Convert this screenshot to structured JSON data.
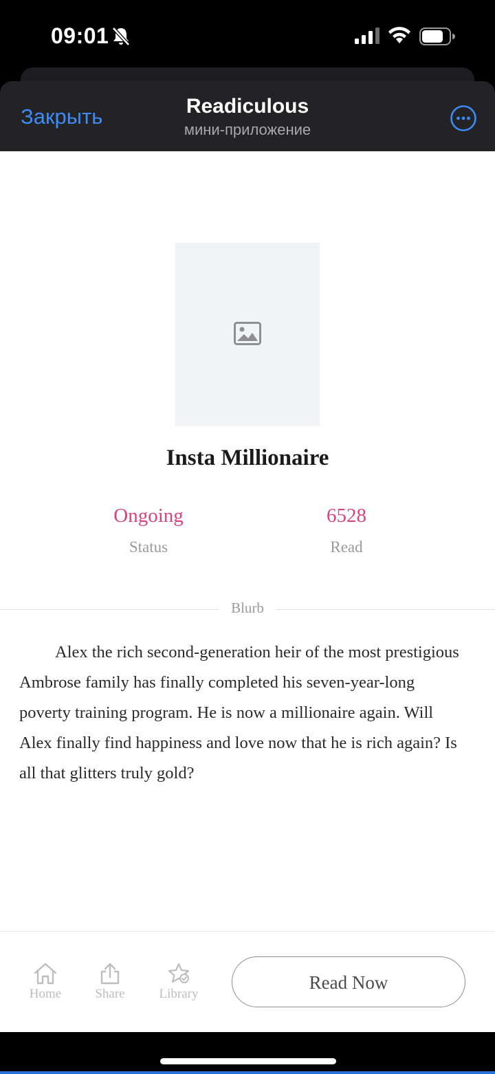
{
  "status_bar": {
    "time": "09:01",
    "icons": [
      "bell-slash-icon",
      "cellular-signal-icon",
      "wifi-icon",
      "battery-icon"
    ]
  },
  "mini_header": {
    "close_label": "Закрыть",
    "title": "Readiculous",
    "subtitle": "мини-приложение",
    "more_icon": "ellipsis-circle-icon",
    "accent_color": "#3d8bf7"
  },
  "book": {
    "cover_icon": "image-placeholder-icon",
    "title": "Insta Millionaire",
    "stats": {
      "status_value": "Ongoing",
      "status_label": "Status",
      "read_value": "6528",
      "read_label": "Read"
    },
    "stat_color": "#d6457f",
    "blurb_label": "Blurb",
    "blurb": "Alex the rich second-generation heir of the most prestigious Ambrose family has finally completed his seven-year-long poverty training program. He is now a millionaire again. Will Alex finally find happiness and love now that he is rich again? Is all that glitters truly gold?"
  },
  "bottom_nav": {
    "home_label": "Home",
    "share_label": "Share",
    "library_label": "Library",
    "read_now_label": "Read Now"
  }
}
